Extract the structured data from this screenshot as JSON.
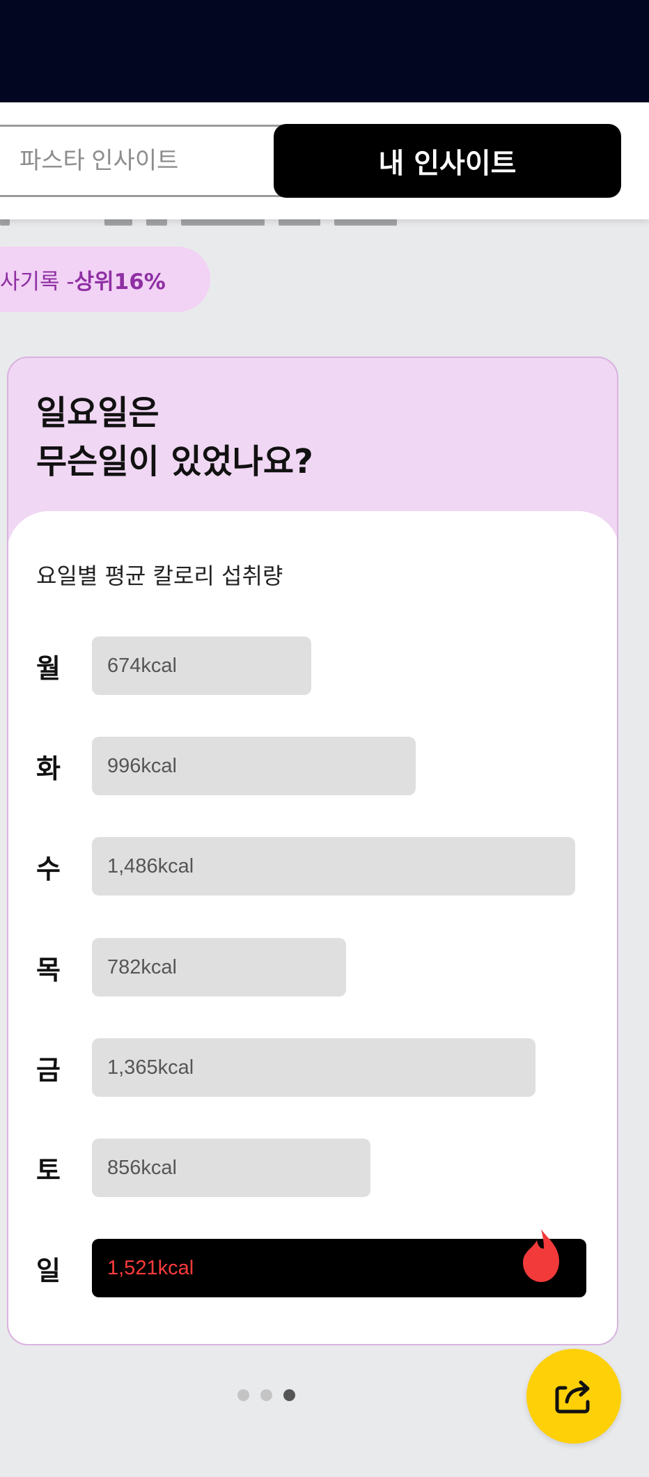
{
  "tabs": {
    "inactive_label": "파스타 인사이트",
    "active_label": "내 인사이트"
  },
  "rank_pill": {
    "label": "사기록 - ",
    "value": "상위16%"
  },
  "card": {
    "title_line1": "일요일은",
    "title_line2": "무슨일이 있었나요?",
    "caption": "요일별 평균 칼로리 섭취량"
  },
  "colors": {
    "accent_purple": "#8e2fa3",
    "highlight_red": "#ff3b3b",
    "fab_yellow": "#fdd008"
  },
  "chart_data": {
    "type": "bar",
    "orientation": "horizontal",
    "title": "요일별 평균 칼로리 섭취량",
    "categories": [
      "월",
      "화",
      "수",
      "목",
      "금",
      "토",
      "일"
    ],
    "values": [
      674,
      996,
      1486,
      782,
      1365,
      856,
      1521
    ],
    "value_labels": [
      "674kcal",
      "996kcal",
      "1,486kcal",
      "782kcal",
      "1,365kcal",
      "856kcal",
      "1,521kcal"
    ],
    "unit": "kcal",
    "highlight_index": 6,
    "highlight_icon": "flame-icon"
  },
  "pager": {
    "page_count": 3,
    "active_index": 2
  },
  "share_button": {
    "icon": "share-icon"
  }
}
